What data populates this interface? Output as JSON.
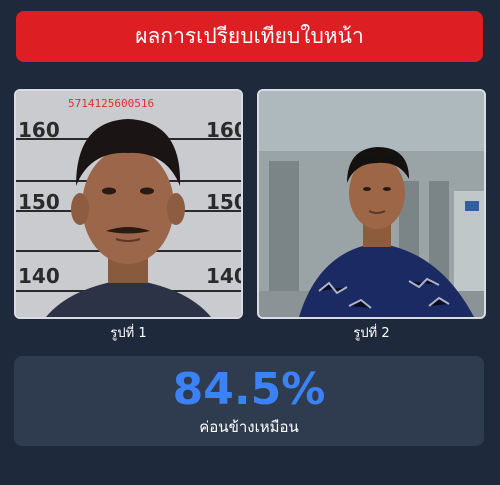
{
  "header": {
    "title": "ผลการเปรียบเทียบใบหน้า"
  },
  "photos": [
    {
      "caption": "รูปที่ 1",
      "overlay_text": "5714125600516",
      "height_marks": [
        "160",
        "150",
        "140"
      ]
    },
    {
      "caption": "รูปที่ 2"
    }
  ],
  "result": {
    "score": "84.5%",
    "verdict": "ค่อนข้างเหมือน"
  },
  "colors": {
    "accent": "#dd1f24",
    "score": "#3b82f6",
    "background": "#1e2a3c",
    "panel": "#2f3b4e"
  }
}
